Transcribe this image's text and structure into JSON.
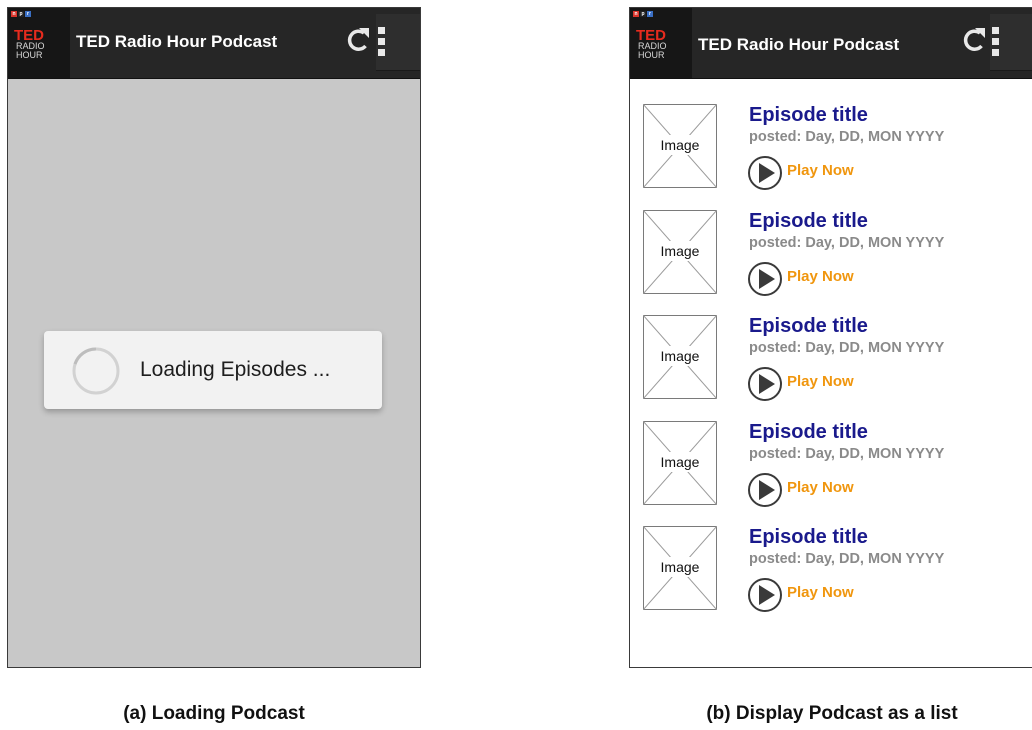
{
  "app": {
    "npr_letters": [
      "n",
      "p",
      "r"
    ],
    "logo_ted": "TED",
    "logo_radio": "RADIO",
    "logo_hour": "HOUR",
    "title": "TED Radio Hour Podcast"
  },
  "loading": {
    "text": "Loading Episodes ..."
  },
  "list": {
    "thumb_label": "Image",
    "episodes": [
      {
        "title": "Episode title",
        "posted": "posted: Day, DD, MON YYYY",
        "play_label": "Play Now"
      },
      {
        "title": "Episode title",
        "posted": "posted: Day, DD, MON YYYY",
        "play_label": "Play Now"
      },
      {
        "title": "Episode title",
        "posted": "posted: Day, DD, MON YYYY",
        "play_label": "Play Now"
      },
      {
        "title": "Episode title",
        "posted": "posted: Day, DD, MON YYYY",
        "play_label": "Play Now"
      },
      {
        "title": "Episode title",
        "posted": "posted: Day, DD, MON YYYY",
        "play_label": "Play Now"
      }
    ]
  },
  "captions": {
    "a": "(a) Loading Podcast",
    "b": "(b) Display Podcast as a list"
  },
  "icons": {
    "refresh": "refresh-icon",
    "overflow": "overflow-menu-icon",
    "spinner": "spinner-icon",
    "play": "play-circle-icon",
    "thumb": "image-placeholder-icon"
  },
  "colors": {
    "action_bar": "#262626",
    "ted_red": "#e62b1e",
    "episode_title": "#1a1a8c",
    "posted": "#8a8a8a",
    "play_now": "#f0960e",
    "loading_bg": "#c8c8c8"
  }
}
